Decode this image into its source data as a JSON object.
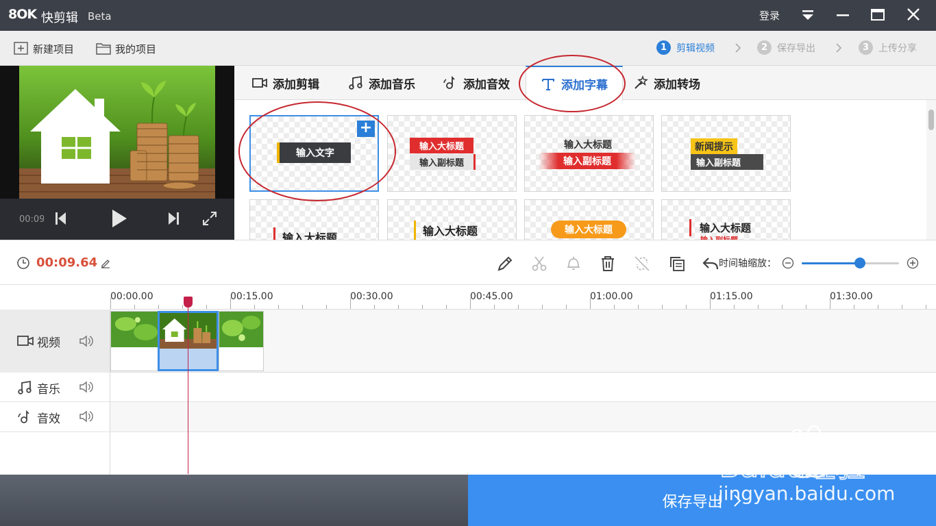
{
  "titlebar": {
    "logo": "8OK",
    "app_name": "快剪辑",
    "beta": "Beta",
    "login": "登录"
  },
  "menubar": {
    "new_project": "新建项目",
    "my_projects": "我的项目",
    "steps": [
      {
        "num": "1",
        "label": "剪辑视频"
      },
      {
        "num": "2",
        "label": "保存导出"
      },
      {
        "num": "3",
        "label": "上传分享"
      }
    ]
  },
  "preview": {
    "timecode": "00:09"
  },
  "tabs": [
    {
      "label": "添加剪辑",
      "icon": "video-camera-icon"
    },
    {
      "label": "添加音乐",
      "icon": "music-note-icon"
    },
    {
      "label": "添加音效",
      "icon": "sound-effect-icon"
    },
    {
      "label": "添加字幕",
      "icon": "text-t-icon"
    },
    {
      "label": "添加转场",
      "icon": "transition-wand-icon"
    }
  ],
  "templates": {
    "t1": "输入文字",
    "t2_title": "输入大标题",
    "t2_sub": "输入副标题",
    "t3_title": "输入大标题",
    "t3_sub": "输入副标题",
    "t4_title": "新闻提示",
    "t4_sub": "输入副标题",
    "t5_title": "输入大标题",
    "t6_title": "输入大标题",
    "t7_title": "输入大标题",
    "t8_title": "输入大标题",
    "t8_sub": "输入副标题",
    "plus": "+"
  },
  "toolbar": {
    "duration": "00:09.64",
    "zoom_label": "时间轴缩放：",
    "zoom_level": 0.6
  },
  "ruler": {
    "ticks": [
      "00:00.00",
      "00:15.00",
      "00:30.00",
      "00:45.00",
      "01:00.00",
      "01:15.00",
      "01:30.00"
    ]
  },
  "tracks": {
    "video": "视频",
    "music": "音乐",
    "sfx": "音效"
  },
  "bottom": {
    "export": "保存导出"
  },
  "watermark": {
    "brand": "Baidu经验",
    "url": "jingyan.baidu.com"
  },
  "colors": {
    "accent": "#2b7fd8",
    "duration": "#d9503a",
    "playhead": "#c4204a",
    "export_bg": "#3a8ff0"
  }
}
